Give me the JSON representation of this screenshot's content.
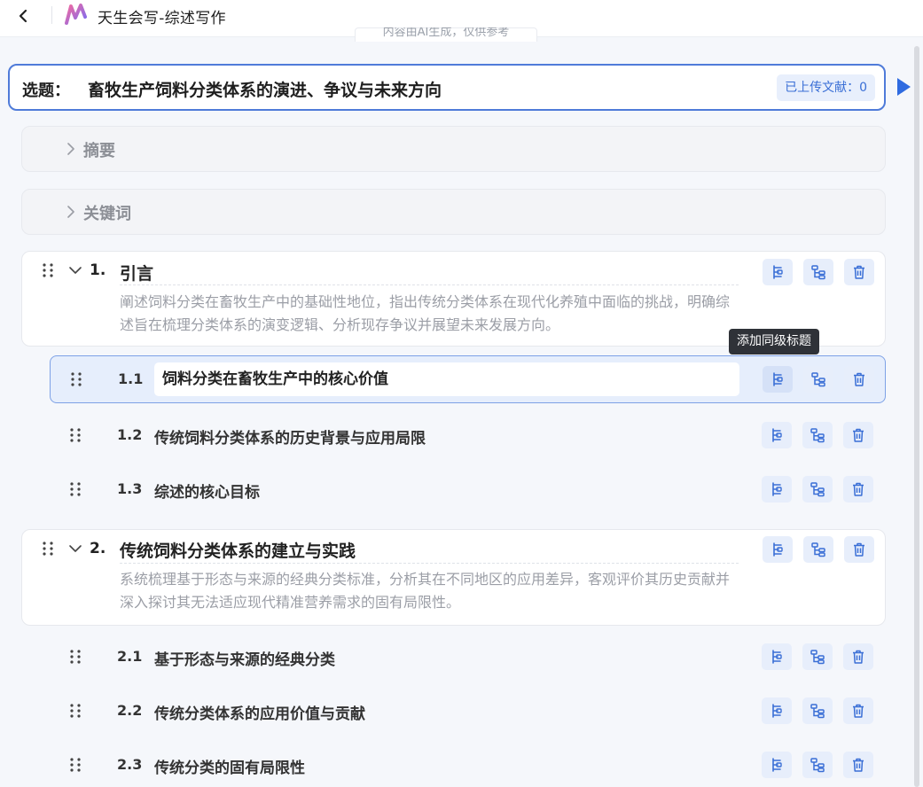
{
  "header": {
    "app_title": "天生会写-综述写作",
    "notice_text": "内容由AI生成，仅供参考"
  },
  "topic": {
    "label": "选题：",
    "title": "畜牧生产饲料分类体系的演进、争议与未来方向",
    "uploaded_docs_label": "已上传文献：0"
  },
  "sections": {
    "abstract_label": "摘要",
    "keywords_label": "关键词"
  },
  "chapters": [
    {
      "number": "1.",
      "title": "引言",
      "description": "阐述饲料分类在畜牧生产中的基础性地位，指出传统分类体系在现代化养殖中面临的挑战，明确综述旨在梳理分类体系的演变逻辑、分析现存争议并展望未来发展方向。",
      "subsections": [
        {
          "number": "1.1",
          "title": "饲料分类在畜牧生产中的核心价值"
        },
        {
          "number": "1.2",
          "title": "传统饲料分类体系的历史背景与应用局限"
        },
        {
          "number": "1.3",
          "title": "综述的核心目标"
        }
      ]
    },
    {
      "number": "2.",
      "title": "传统饲料分类体系的建立与实践",
      "description": "系统梳理基于形态与来源的经典分类标准，分析其在不同地区的应用差异，客观评价其历史贡献并深入探讨其无法适应现代精准营养需求的固有局限性。",
      "subsections": [
        {
          "number": "2.1",
          "title": "基于形态与来源的经典分类"
        },
        {
          "number": "2.2",
          "title": "传统分类体系的应用价值与贡献"
        },
        {
          "number": "2.3",
          "title": "传统分类的固有局限性"
        }
      ]
    }
  ],
  "tooltip": {
    "text": "添加同级标题"
  },
  "colors": {
    "accent": "#3a6fd6",
    "active_row_bg": "#e6eefc",
    "muted_text": "#9b9ea6"
  }
}
